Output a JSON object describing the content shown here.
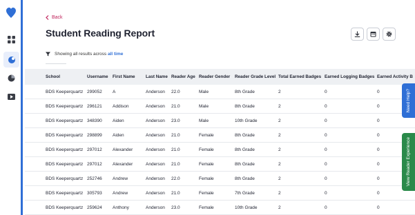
{
  "nav": {
    "items": [
      "dashboard",
      "reading",
      "reports",
      "video"
    ]
  },
  "header": {
    "back_label": "Back",
    "title": "Student Reading Report"
  },
  "filter": {
    "prefix": "Showing all results across",
    "period": "all time"
  },
  "table": {
    "columns": [
      "School",
      "Username",
      "First Name",
      "Last Name",
      "Reader Age",
      "Reader Gender",
      "Reader Grade Level",
      "Total Earned Badges",
      "Earned Logging Badges",
      "Earned Activity B"
    ],
    "rows": [
      [
        "BDS Keeperquartz",
        "299052",
        "A",
        "Anderson",
        "22.0",
        "Male",
        "8th Grade",
        "2",
        "0",
        "0"
      ],
      [
        "BDS Keeperquartz",
        "296121",
        "Addison",
        "Anderson",
        "21.0",
        "Male",
        "8th Grade",
        "2",
        "0",
        "0"
      ],
      [
        "BDS Keeperquartz",
        "348390",
        "Aiden",
        "Anderson",
        "23.0",
        "Male",
        "10th Grade",
        "2",
        "0",
        "0"
      ],
      [
        "BDS Keeperquartz",
        "298899",
        "Aiden",
        "Anderson",
        "21.0",
        "Female",
        "8th Grade",
        "2",
        "0",
        "0"
      ],
      [
        "BDS Keeperquartz",
        "297012",
        "Alexander",
        "Anderson",
        "21.0",
        "Female",
        "8th Grade",
        "2",
        "0",
        "0"
      ],
      [
        "BDS Keeperquartz",
        "297012",
        "Alexander",
        "Anderson",
        "21.0",
        "Female",
        "8th Grade",
        "2",
        "0",
        "0"
      ],
      [
        "BDS Keeperquartz",
        "252746",
        "Andrew",
        "Anderson",
        "22.0",
        "Female",
        "8th Grade",
        "2",
        "0",
        "0"
      ],
      [
        "BDS Keeperquartz",
        "305793",
        "Andrew",
        "Anderson",
        "21.0",
        "Female",
        "7th Grade",
        "2",
        "0",
        "0"
      ],
      [
        "BDS Keeperquartz",
        "259624",
        "Anthony",
        "Anderson",
        "23.0",
        "Female",
        "10th Grade",
        "2",
        "0",
        "0"
      ]
    ]
  },
  "side_tabs": {
    "help": "Need Help?",
    "reader": "View Reader Experience"
  },
  "colors": {
    "accent": "#2f6fd6",
    "back_link": "#c0245c",
    "reader_tab": "#2a8a4a"
  }
}
